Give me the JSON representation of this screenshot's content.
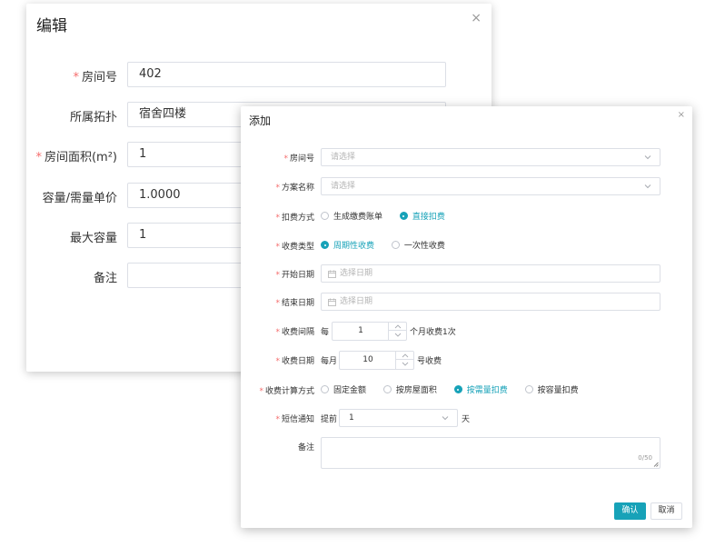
{
  "edit_dialog": {
    "title": "编辑",
    "close_glyph": "×",
    "fields": [
      {
        "label": "房间号",
        "required": true,
        "value": "402"
      },
      {
        "label": "所属拓扑",
        "required": false,
        "value": "宿舍四楼"
      },
      {
        "label": "房间面积(m²)",
        "required": true,
        "value": "1"
      },
      {
        "label": "容量/需量单价",
        "required": false,
        "value": "1.0000"
      },
      {
        "label": "最大容量",
        "required": false,
        "value": "1"
      },
      {
        "label": "备注",
        "required": false,
        "value": ""
      }
    ]
  },
  "add_dialog": {
    "title": "添加",
    "close_glyph": "×",
    "required_mark": "*",
    "room": {
      "label": "房间号",
      "placeholder": "请选择"
    },
    "plan": {
      "label": "方案名称",
      "placeholder": "请选择"
    },
    "deduct_mode": {
      "label": "扣费方式",
      "options": [
        "生成缴费账单",
        "直接扣费"
      ],
      "selected": 1
    },
    "charge_type": {
      "label": "收费类型",
      "options": [
        "周期性收费",
        "一次性收费"
      ],
      "selected": 0
    },
    "start_date": {
      "label": "开始日期",
      "placeholder": "选择日期"
    },
    "end_date": {
      "label": "结束日期",
      "placeholder": "选择日期"
    },
    "interval": {
      "label": "收费间隔",
      "prefix": "每",
      "value": "1",
      "suffix": "个月收费1次"
    },
    "charge_day": {
      "label": "收费日期",
      "prefix": "每月",
      "value": "10",
      "suffix": "号收费"
    },
    "calc_mode": {
      "label": "收费计算方式",
      "options": [
        "固定金额",
        "按房屋面积",
        "按需量扣费",
        "按容量扣费"
      ],
      "selected": 2
    },
    "sms": {
      "label": "短信通知",
      "prefix": "提前",
      "value": "1",
      "suffix": "天"
    },
    "remark": {
      "label": "备注",
      "counter": "0/50"
    },
    "confirm_label": "确认",
    "cancel_label": "取消"
  },
  "colors": {
    "accent": "#17a2b8",
    "required": "#f56c6c",
    "border": "#dcdfe6"
  },
  "icons": [
    "close-icon",
    "chevron-down-icon",
    "calendar-icon",
    "chevron-up-icon",
    "resize-grip-icon"
  ]
}
